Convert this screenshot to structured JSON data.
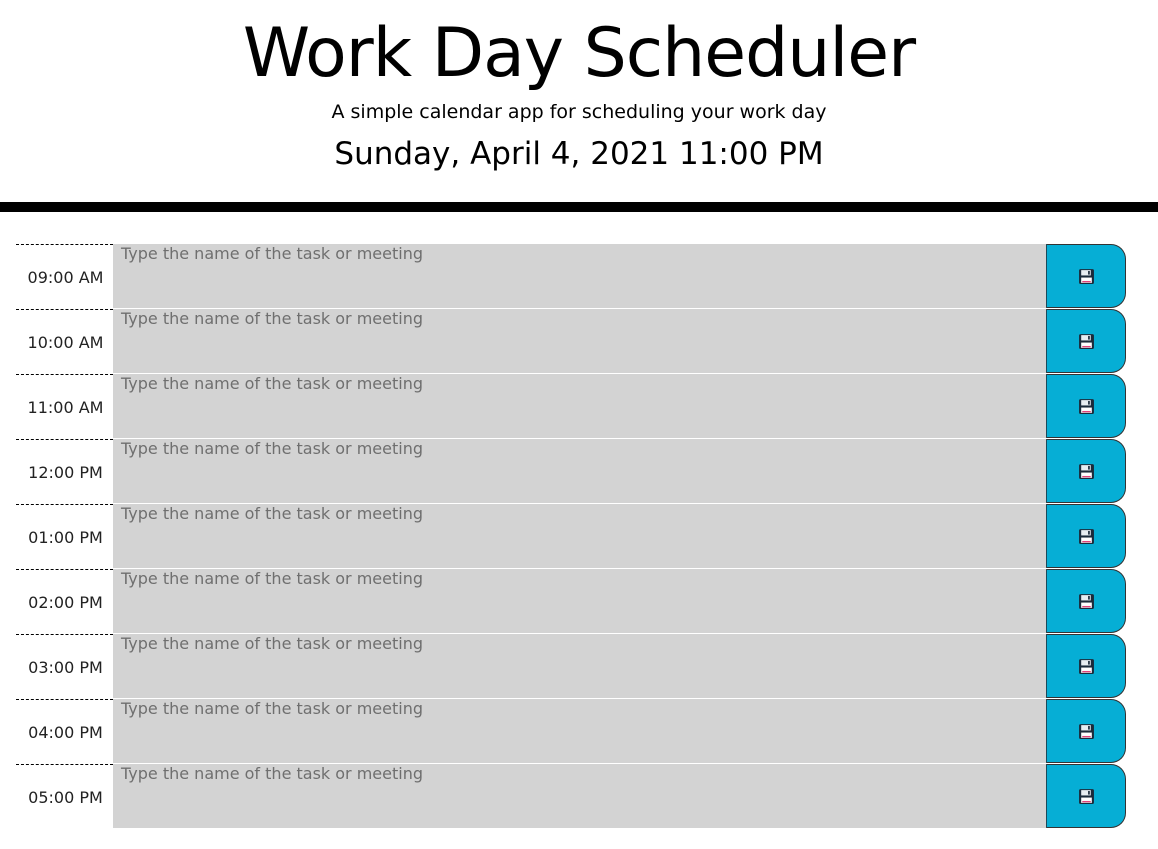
{
  "header": {
    "title": "Work Day Scheduler",
    "lead": "A simple calendar app for scheduling your work day",
    "current_day": "Sunday, April 4, 2021 11:00 PM"
  },
  "colors": {
    "row_background": "#d3d3d3",
    "save_button": "#06aed5",
    "header_border": "#000000"
  },
  "time_blocks": [
    {
      "hour": "09:00 AM",
      "placeholder": "Type the name of the task or meeting",
      "value": "",
      "save_icon": "floppy-disk-icon"
    },
    {
      "hour": "10:00 AM",
      "placeholder": "Type the name of the task or meeting",
      "value": "",
      "save_icon": "floppy-disk-icon"
    },
    {
      "hour": "11:00 AM",
      "placeholder": "Type the name of the task or meeting",
      "value": "",
      "save_icon": "floppy-disk-icon"
    },
    {
      "hour": "12:00 PM",
      "placeholder": "Type the name of the task or meeting",
      "value": "",
      "save_icon": "floppy-disk-icon"
    },
    {
      "hour": "01:00 PM",
      "placeholder": "Type the name of the task or meeting",
      "value": "",
      "save_icon": "floppy-disk-icon"
    },
    {
      "hour": "02:00 PM",
      "placeholder": "Type the name of the task or meeting",
      "value": "",
      "save_icon": "floppy-disk-icon"
    },
    {
      "hour": "03:00 PM",
      "placeholder": "Type the name of the task or meeting",
      "value": "",
      "save_icon": "floppy-disk-icon"
    },
    {
      "hour": "04:00 PM",
      "placeholder": "Type the name of the task or meeting",
      "value": "",
      "save_icon": "floppy-disk-icon"
    },
    {
      "hour": "05:00 PM",
      "placeholder": "Type the name of the task or meeting",
      "value": "",
      "save_icon": "floppy-disk-icon"
    }
  ]
}
